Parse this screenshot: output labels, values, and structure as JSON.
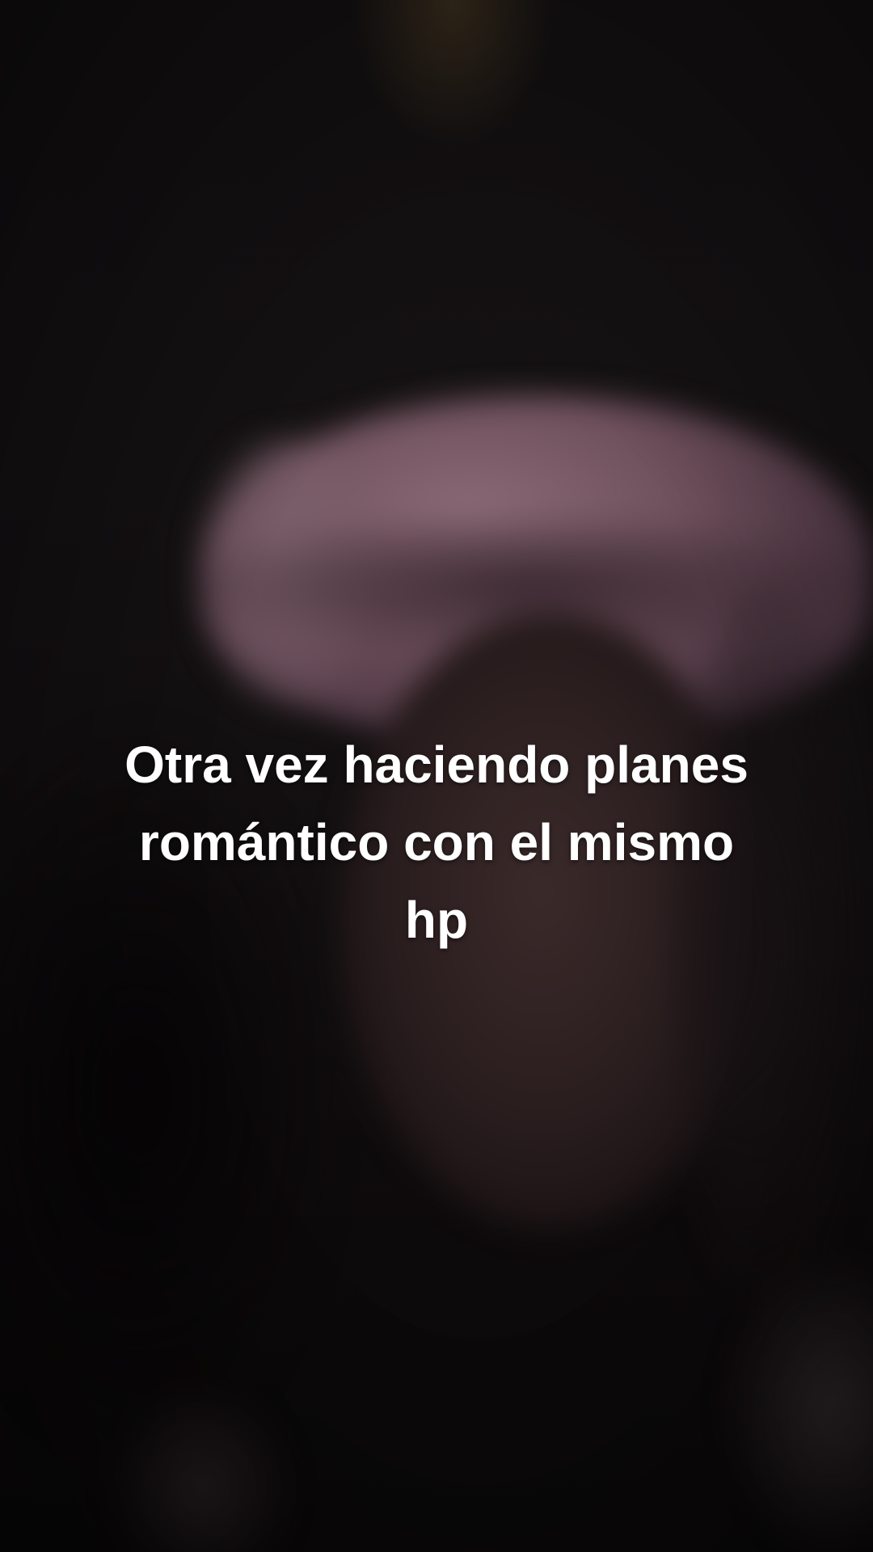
{
  "video": {
    "caption_lines": [
      "Otra vez haciendo planes",
      "romántico con el mismo",
      "hp"
    ]
  }
}
